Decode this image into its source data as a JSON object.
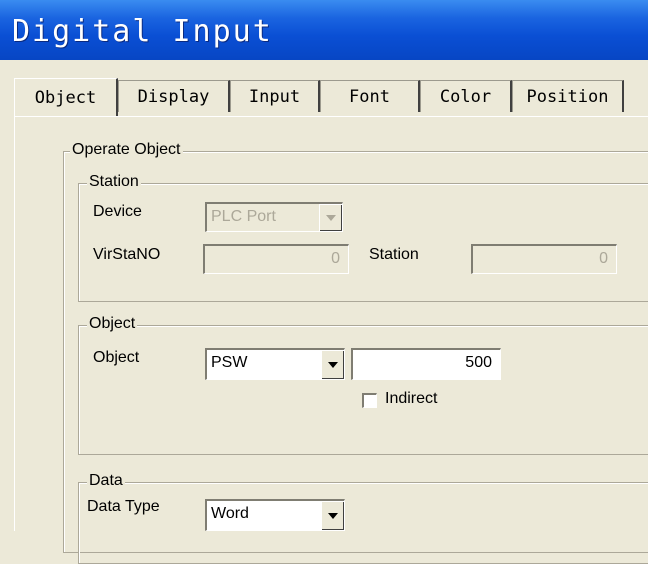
{
  "window": {
    "title": "Digital Input"
  },
  "tabs": [
    {
      "label": "Object"
    },
    {
      "label": "Display"
    },
    {
      "label": "Input"
    },
    {
      "label": "Font"
    },
    {
      "label": "Color"
    },
    {
      "label": "Position"
    }
  ],
  "operate_object": {
    "title": "Operate Object",
    "station": {
      "title": "Station",
      "device_label": "Device",
      "device_value": "PLC Port",
      "virstano_label": "VirStaNO",
      "virstano_value": "0",
      "station_label": "Station",
      "station_value": "0"
    },
    "object": {
      "title": "Object",
      "object_label": "Object",
      "object_type": "PSW",
      "object_address": "500",
      "indirect_label": "Indirect",
      "indirect_checked": false
    },
    "data": {
      "title": "Data",
      "data_type_label": "Data Type",
      "data_type_value": "Word"
    }
  }
}
